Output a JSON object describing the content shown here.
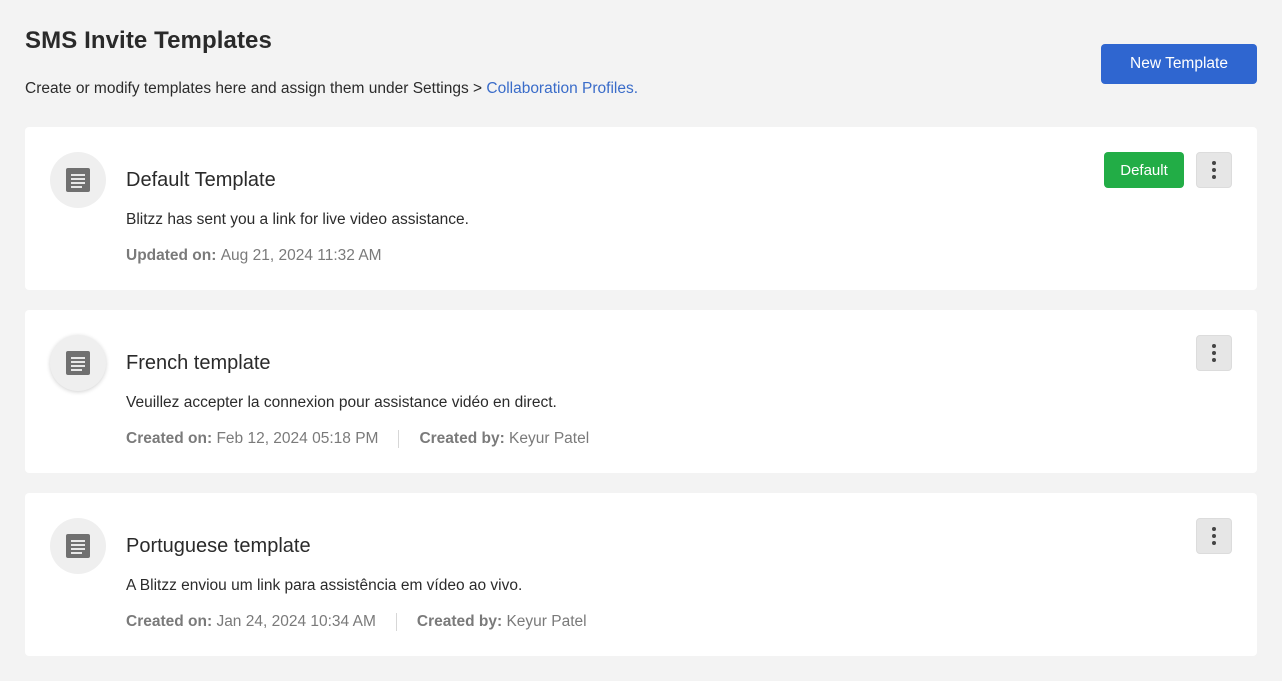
{
  "header": {
    "title": "SMS Invite Templates",
    "subtitle": "Create or modify templates here and assign them under Settings > ",
    "subtitle_link": "Collaboration Profiles.",
    "new_button": "New Template"
  },
  "templates": [
    {
      "name": "Default Template",
      "message": "Blitzz has sent you a link for live video assistance.",
      "date_label": "Updated on:",
      "date_value": "Aug 21, 2024 11:32 AM",
      "badge": "Default",
      "menu_icon": "kebab-icon"
    },
    {
      "name": "French template",
      "message": "Veuillez accepter la connexion pour assistance vidéo en direct.",
      "date_label": "Created on:",
      "date_value": "Feb 12, 2024 05:18 PM",
      "author_label": "Created by:",
      "author_value": "Keyur Patel",
      "menu_icon": "kebab-icon"
    },
    {
      "name": "Portuguese template",
      "message": "A Blitzz enviou um link para assistência em vídeo ao vivo.",
      "date_label": "Created on:",
      "date_value": "Jan 24, 2024 10:34 AM",
      "author_label": "Created by:",
      "author_value": "Keyur Patel",
      "menu_icon": "kebab-icon"
    }
  ],
  "colors": {
    "primary": "#2f66d0",
    "link": "#3a6cc9",
    "default_badge": "#22ad46",
    "background": "#f3f3f3"
  }
}
